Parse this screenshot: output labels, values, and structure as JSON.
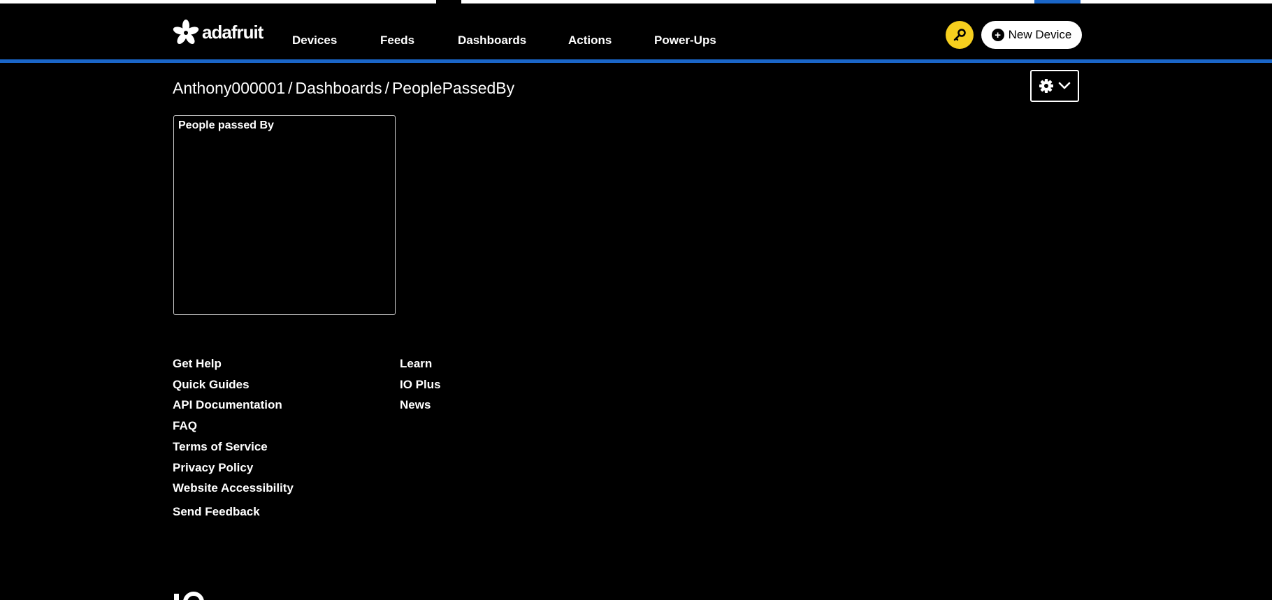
{
  "brand": {
    "name": "adafruit",
    "accent_color": "#1a66c8",
    "key_color": "#f6cf1e"
  },
  "nav": {
    "items": [
      {
        "label": "Devices"
      },
      {
        "label": "Feeds"
      },
      {
        "label": "Dashboards"
      },
      {
        "label": "Actions"
      },
      {
        "label": "Power-Ups"
      }
    ],
    "new_device_label": "New Device",
    "key_icon": "key-icon",
    "plus_icon": "plus-circle-icon"
  },
  "breadcrumb": {
    "user": "Anthony000001",
    "separator": "/",
    "section": "Dashboards",
    "dashboard": "PeoplePassedBy"
  },
  "settings": {
    "icons": [
      "gear-icon",
      "chevron-down-icon"
    ]
  },
  "blocks": [
    {
      "title": "People passed By"
    }
  ],
  "footer": {
    "column1": [
      {
        "label": "Get Help"
      },
      {
        "label": "Quick Guides"
      },
      {
        "label": "API Documentation"
      },
      {
        "label": "FAQ"
      },
      {
        "label": "Terms of Service"
      },
      {
        "label": "Privacy Policy"
      },
      {
        "label": "Website Accessibility"
      },
      {
        "label": "Send Feedback"
      }
    ],
    "column2": [
      {
        "label": "Learn"
      },
      {
        "label": "IO Plus"
      },
      {
        "label": "News"
      }
    ]
  }
}
